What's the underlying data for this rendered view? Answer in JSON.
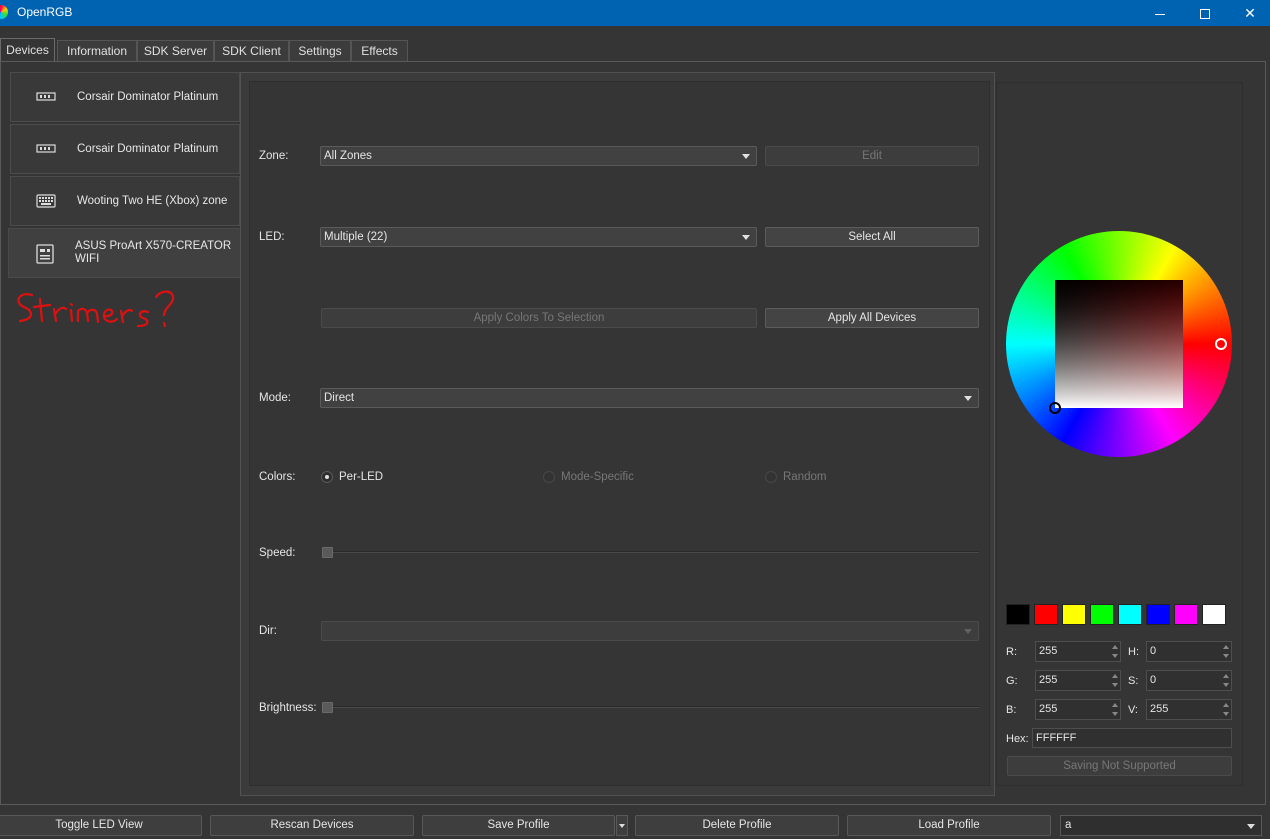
{
  "window": {
    "title": "OpenRGB",
    "minimize_icon": "minimize-icon",
    "maximize_icon": "maximize-icon",
    "close_glyph": "✕"
  },
  "tabs": [
    {
      "label": "Devices"
    },
    {
      "label": "Information"
    },
    {
      "label": "SDK Server"
    },
    {
      "label": "SDK Client"
    },
    {
      "label": "Settings"
    },
    {
      "label": "Effects"
    }
  ],
  "devices": [
    {
      "label": "Corsair Dominator Platinum",
      "icon": "ram-icon"
    },
    {
      "label": "Corsair Dominator Platinum",
      "icon": "ram-icon"
    },
    {
      "label": "Wooting Two HE (Xbox) zone",
      "icon": "keyboard-icon"
    },
    {
      "label": "ASUS ProArt X570-CREATOR WIFI",
      "icon": "motherboard-icon"
    }
  ],
  "annotation": {
    "text": "Strimers?",
    "color": "#e01010"
  },
  "controls": {
    "zone_label": "Zone:",
    "zone_value": "All Zones",
    "edit_label": "Edit",
    "led_label": "LED:",
    "led_value": "Multiple (22)",
    "select_all_label": "Select All",
    "apply_selection_label": "Apply Colors To Selection",
    "apply_all_label": "Apply All Devices",
    "mode_label": "Mode:",
    "mode_value": "Direct",
    "colors_label": "Colors:",
    "per_led_label": "Per-LED",
    "mode_specific_label": "Mode-Specific",
    "random_label": "Random",
    "speed_label": "Speed:",
    "dir_label": "Dir:",
    "dir_value": "",
    "brightness_label": "Brightness:"
  },
  "color_picker": {
    "swatches": [
      "#000000",
      "#ff0000",
      "#ffff00",
      "#00ff00",
      "#00ffff",
      "#0000ff",
      "#ff00ff",
      "#ffffff"
    ],
    "r_label": "R:",
    "r_value": "255",
    "g_label": "G:",
    "g_value": "255",
    "b_label": "B:",
    "b_value": "255",
    "h_label": "H:",
    "h_value": "0",
    "s_label": "S:",
    "s_value": "0",
    "v_label": "V:",
    "v_value": "255",
    "hex_label": "Hex:",
    "hex_value": "FFFFFF",
    "saving_label": "Saving Not Supported"
  },
  "bottom": {
    "toggle_led_view": "Toggle LED View",
    "rescan_devices": "Rescan Devices",
    "save_profile": "Save Profile",
    "delete_profile": "Delete Profile",
    "load_profile": "Load Profile",
    "profile_value": "a"
  }
}
